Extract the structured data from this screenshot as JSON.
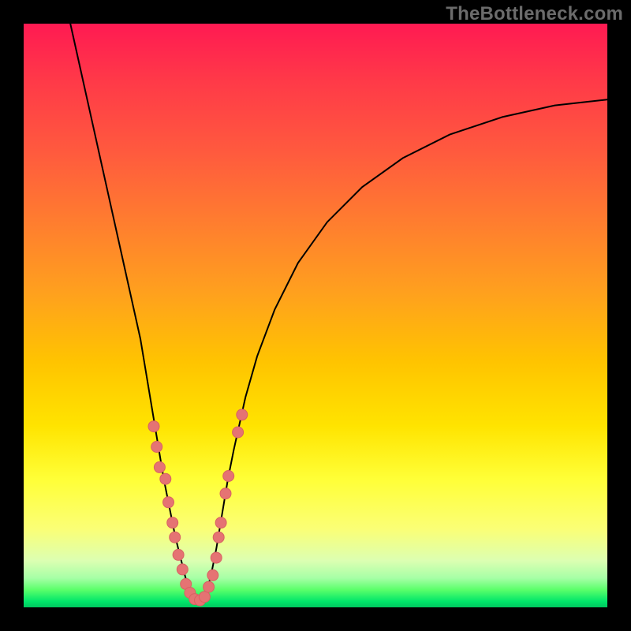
{
  "watermark": "TheBottleneck.com",
  "chart_data": {
    "type": "line",
    "title": "",
    "xlabel": "",
    "ylabel": "",
    "xlim": [
      0,
      100
    ],
    "ylim": [
      0,
      100
    ],
    "curve": {
      "left_branch": [
        {
          "x": 8,
          "y": 100
        },
        {
          "x": 10,
          "y": 91
        },
        {
          "x": 12,
          "y": 82
        },
        {
          "x": 14,
          "y": 73
        },
        {
          "x": 16,
          "y": 64
        },
        {
          "x": 18,
          "y": 55
        },
        {
          "x": 20,
          "y": 46
        },
        {
          "x": 21,
          "y": 40
        },
        {
          "x": 22,
          "y": 34
        },
        {
          "x": 23,
          "y": 28
        },
        {
          "x": 24,
          "y": 22
        },
        {
          "x": 25,
          "y": 17
        },
        {
          "x": 26,
          "y": 12
        },
        {
          "x": 27,
          "y": 8
        },
        {
          "x": 28,
          "y": 4
        },
        {
          "x": 29,
          "y": 2
        },
        {
          "x": 30,
          "y": 1
        }
      ],
      "right_branch": [
        {
          "x": 30,
          "y": 1
        },
        {
          "x": 31,
          "y": 2
        },
        {
          "x": 32,
          "y": 5
        },
        {
          "x": 33,
          "y": 10
        },
        {
          "x": 34,
          "y": 16
        },
        {
          "x": 35,
          "y": 22
        },
        {
          "x": 36,
          "y": 27
        },
        {
          "x": 38,
          "y": 36
        },
        {
          "x": 40,
          "y": 43
        },
        {
          "x": 43,
          "y": 51
        },
        {
          "x": 47,
          "y": 59
        },
        {
          "x": 52,
          "y": 66
        },
        {
          "x": 58,
          "y": 72
        },
        {
          "x": 65,
          "y": 77
        },
        {
          "x": 73,
          "y": 81
        },
        {
          "x": 82,
          "y": 84
        },
        {
          "x": 91,
          "y": 86
        },
        {
          "x": 100,
          "y": 87
        }
      ]
    },
    "scatter_points": [
      {
        "x": 22.3,
        "y": 31
      },
      {
        "x": 22.8,
        "y": 27.5
      },
      {
        "x": 23.3,
        "y": 24
      },
      {
        "x": 24.3,
        "y": 22
      },
      {
        "x": 24.8,
        "y": 18
      },
      {
        "x": 25.5,
        "y": 14.5
      },
      {
        "x": 25.9,
        "y": 12
      },
      {
        "x": 26.5,
        "y": 9
      },
      {
        "x": 27.2,
        "y": 6.5
      },
      {
        "x": 27.8,
        "y": 4
      },
      {
        "x": 28.5,
        "y": 2.5
      },
      {
        "x": 29.3,
        "y": 1.4
      },
      {
        "x": 30.2,
        "y": 1.2
      },
      {
        "x": 31.0,
        "y": 1.8
      },
      {
        "x": 31.7,
        "y": 3.5
      },
      {
        "x": 32.4,
        "y": 5.5
      },
      {
        "x": 33.0,
        "y": 8.5
      },
      {
        "x": 33.4,
        "y": 12
      },
      {
        "x": 33.8,
        "y": 14.5
      },
      {
        "x": 34.6,
        "y": 19.5
      },
      {
        "x": 35.1,
        "y": 22.5
      },
      {
        "x": 36.7,
        "y": 30
      },
      {
        "x": 37.4,
        "y": 33
      }
    ],
    "gradient_background": {
      "type": "red-yellow-green",
      "description": "vertical heatmap gradient (red top, yellow middle, green bottom)"
    }
  }
}
